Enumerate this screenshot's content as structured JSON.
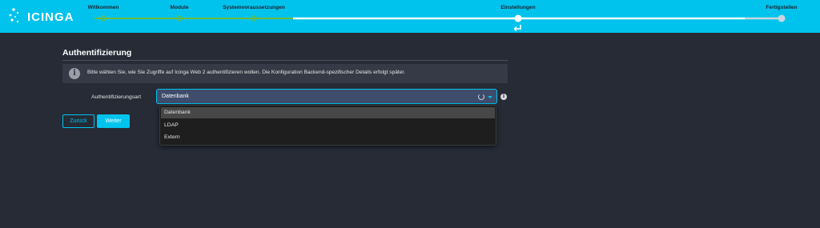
{
  "brand": {
    "name": "ICINGA",
    "accent": "#00c3ed",
    "done_color": "#6cbb3c"
  },
  "steps": [
    {
      "label": "Willkommen",
      "state": "done"
    },
    {
      "label": "Module",
      "state": "done"
    },
    {
      "label": "Systemvoraussetzungen",
      "state": "done"
    },
    {
      "label": "Einstellungen",
      "state": "current"
    },
    {
      "label": "Fertigstellen",
      "state": "pending"
    }
  ],
  "section": {
    "title": "Authentifizierung",
    "info_text": "Bitte wählen Sie, wie Sie Zugriffe auf Icinga Web 2 authentifizieren wollen. Die Konfiguration Backend-spezifischer Details erfolgt später."
  },
  "form": {
    "auth_label": "Authentifizierungsart",
    "auth_value": "Datenbank",
    "options": [
      "Datenbank",
      "LDAP",
      "Extern"
    ]
  },
  "buttons": {
    "back": "Zurück",
    "next": "Weiter"
  },
  "icons": {
    "info": "info-icon",
    "help": "help-icon",
    "caret": "chevron-down-icon",
    "loading": "spinner-icon",
    "current_step": "return-arrow-icon"
  }
}
